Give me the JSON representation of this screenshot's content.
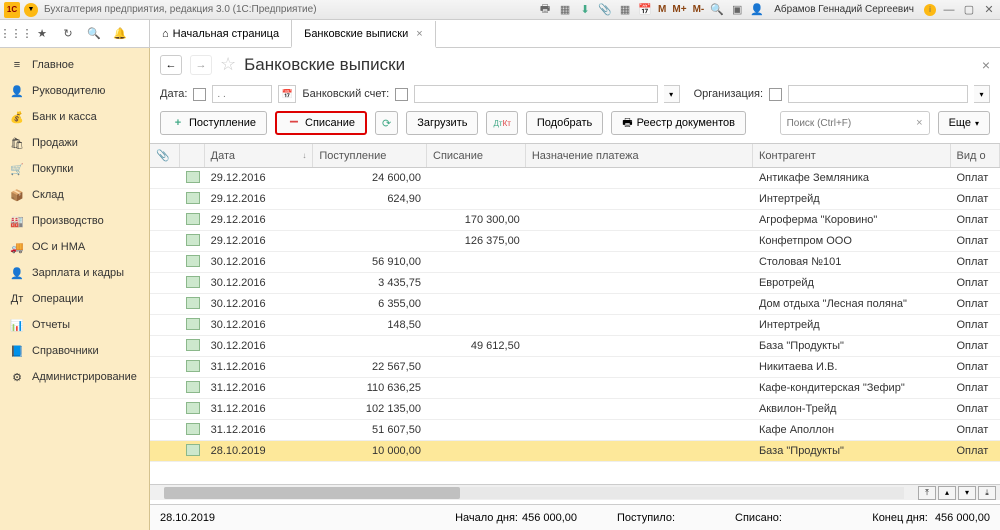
{
  "titlebar": {
    "app_title": "Бухгалтерия предприятия, редакция 3.0 (1С:Предприятие)",
    "user": "Абрамов Геннадий Сергеевич",
    "m": "M",
    "m_plus": "M+",
    "m_minus": "M-"
  },
  "tabs": {
    "home": "Начальная страница",
    "active": "Банковские выписки"
  },
  "sidebar": {
    "items": [
      {
        "label": "Главное",
        "icon": "≡"
      },
      {
        "label": "Руководителю",
        "icon": "👤"
      },
      {
        "label": "Банк и касса",
        "icon": "💰"
      },
      {
        "label": "Продажи",
        "icon": "🛍"
      },
      {
        "label": "Покупки",
        "icon": "🛒"
      },
      {
        "label": "Склад",
        "icon": "📦"
      },
      {
        "label": "Производство",
        "icon": "🏭"
      },
      {
        "label": "ОС и НМА",
        "icon": "🚚"
      },
      {
        "label": "Зарплата и кадры",
        "icon": "👤"
      },
      {
        "label": "Операции",
        "icon": "Дт"
      },
      {
        "label": "Отчеты",
        "icon": "📊"
      },
      {
        "label": "Справочники",
        "icon": "📘"
      },
      {
        "label": "Администрирование",
        "icon": "⚙"
      }
    ]
  },
  "page": {
    "title": "Банковские выписки",
    "filters": {
      "date_label": "Дата:",
      "date_placeholder": ". .",
      "account_label": "Банковский счет:",
      "org_label": "Организация:"
    },
    "buttons": {
      "income": "Поступление",
      "expense": "Списание",
      "load": "Загрузить",
      "pick": "Подобрать",
      "registry": "Реестр документов",
      "more": "Еще",
      "search_placeholder": "Поиск (Ctrl+F)"
    },
    "columns": {
      "date": "Дата",
      "income": "Поступление",
      "expense": "Списание",
      "purpose": "Назначение платежа",
      "agent": "Контрагент",
      "type": "Вид о"
    },
    "rows": [
      {
        "date": "29.12.2016",
        "in": "24 600,00",
        "out": "",
        "agent": "Антикафе Земляника",
        "type": "Оплат"
      },
      {
        "date": "29.12.2016",
        "in": "624,90",
        "out": "",
        "agent": "Интертрейд",
        "type": "Оплат"
      },
      {
        "date": "29.12.2016",
        "in": "",
        "out": "170 300,00",
        "agent": "Агроферма \"Коровино\"",
        "type": "Оплат"
      },
      {
        "date": "29.12.2016",
        "in": "",
        "out": "126 375,00",
        "agent": "Конфетпром ООО",
        "type": "Оплат"
      },
      {
        "date": "30.12.2016",
        "in": "56 910,00",
        "out": "",
        "agent": "Столовая №101",
        "type": "Оплат"
      },
      {
        "date": "30.12.2016",
        "in": "3 435,75",
        "out": "",
        "agent": "Евротрейд",
        "type": "Оплат"
      },
      {
        "date": "30.12.2016",
        "in": "6 355,00",
        "out": "",
        "agent": "Дом отдыха \"Лесная поляна\"",
        "type": "Оплат"
      },
      {
        "date": "30.12.2016",
        "in": "148,50",
        "out": "",
        "agent": "Интертрейд",
        "type": "Оплат"
      },
      {
        "date": "30.12.2016",
        "in": "",
        "out": "49 612,50",
        "agent": "База \"Продукты\"",
        "type": "Оплат"
      },
      {
        "date": "31.12.2016",
        "in": "22 567,50",
        "out": "",
        "agent": "Никитаева И.В.",
        "type": "Оплат"
      },
      {
        "date": "31.12.2016",
        "in": "110 636,25",
        "out": "",
        "agent": "Кафе-кондитерская \"Зефир\"",
        "type": "Оплат"
      },
      {
        "date": "31.12.2016",
        "in": "102 135,00",
        "out": "",
        "agent": "Аквилон-Трейд",
        "type": "Оплат"
      },
      {
        "date": "31.12.2016",
        "in": "51 607,50",
        "out": "",
        "agent": "Кафе Аполлон",
        "type": "Оплат"
      },
      {
        "date": "28.10.2019",
        "in": "10 000,00",
        "out": "",
        "agent": "База \"Продукты\"",
        "type": "Оплат",
        "selected": true
      }
    ],
    "status": {
      "date": "28.10.2019",
      "start_label": "Начало дня:",
      "start_val": "456 000,00",
      "in_label": "Поступило:",
      "out_label": "Списано:",
      "end_label": "Конец дня:",
      "end_val": "456 000,00"
    }
  }
}
